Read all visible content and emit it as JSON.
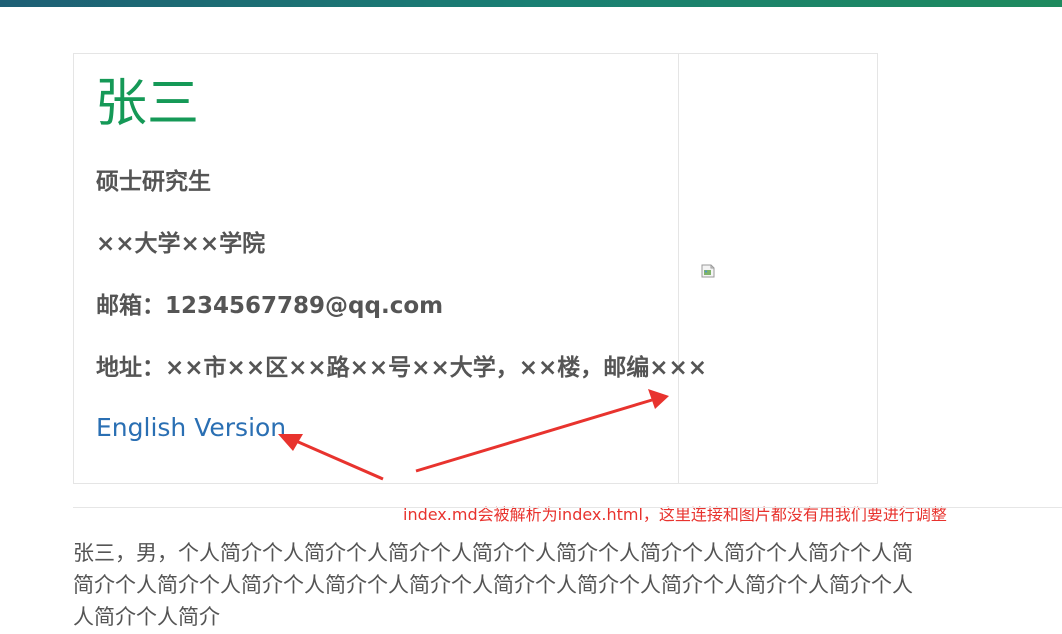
{
  "profile": {
    "name": "张三",
    "degree": "硕士研究生",
    "school": "××大学××学院",
    "email": "邮箱：1234567789@qq.com",
    "address": "地址：××市××区××路××号××大学，××楼，邮编×××",
    "english_link": "English Version",
    "photo_alt": ""
  },
  "annotation": {
    "text": "index.md会被解析为index.html，这里连接和图片都没有用我们要进行调整",
    "color": "#e8332e"
  },
  "bio": {
    "lines": [
      "张三，男，个人简介个人简介个人简介个人简介个人简介个人简介个人简介个人简介个人简",
      "简介个人简介个人简介个人简介个人简介个人简介个人简介个人简介个人简介个人简介个人",
      "人简介个人简介"
    ]
  },
  "colors": {
    "name": "#159957",
    "link": "#2a6fb3",
    "text": "#555555",
    "topbar_start": "#1e5f75",
    "topbar_end": "#1e8a5e"
  },
  "icons": {
    "broken_image": "broken-image-icon"
  }
}
